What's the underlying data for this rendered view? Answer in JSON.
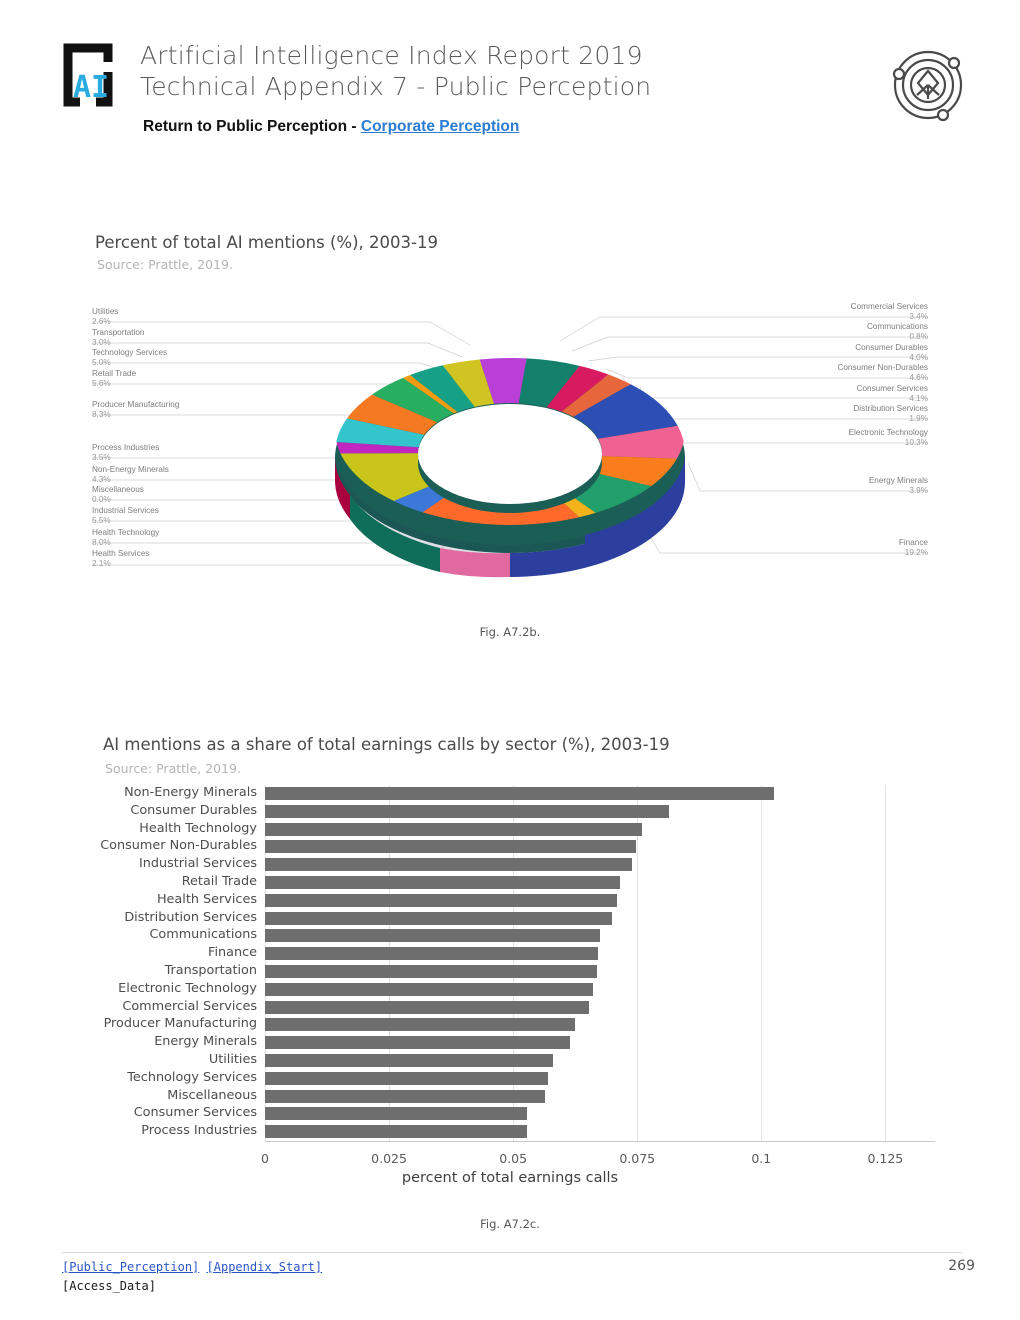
{
  "header": {
    "logo_alt": "AI Index logo",
    "title_line1": "Artificial Intelligence Index Report 2019",
    "title_line2": "Technical Appendix 7 - Public Perception",
    "return_prefix": "Return to Public Perception - ",
    "return_link": "Corporate Perception"
  },
  "figure1": {
    "title": "Percent of total AI mentions (%), 2003-19",
    "source": "Source: Prattle, 2019.",
    "caption": "Fig. A7.2b."
  },
  "figure2": {
    "title": "AI mentions as a share of total earnings calls by sector (%), 2003-19",
    "source": "Source: Prattle, 2019.",
    "caption": "Fig. A7.2c.",
    "xlabel": "percent of total earnings calls"
  },
  "footer": {
    "link1": "[Public_Perception]",
    "link2": "[Appendix_Start]",
    "link3": "[Access_Data]",
    "page": "269"
  },
  "chart_data": [
    {
      "type": "pie",
      "title": "Percent of total AI mentions (%), 2003-19",
      "subtitle": "Source: Prattle, 2019.",
      "unit": "%",
      "donut": true,
      "labels": [
        "Commercial Services",
        "Communications",
        "Consumer Durables",
        "Consumer Non-Durables",
        "Consumer Services",
        "Distribution Services",
        "Electronic Technology",
        "Energy Minerals",
        "Finance",
        "Health Services",
        "Health Technology",
        "Industrial Services",
        "Miscellaneous",
        "Non-Energy Minerals",
        "Process Industries",
        "Producer Manufacturing",
        "Retail Trade",
        "Technology Services",
        "Transportation",
        "Utilities"
      ],
      "values": [
        3.4,
        0.8,
        4.0,
        4.6,
        4.1,
        1.9,
        10.3,
        3.9,
        19.2,
        2.1,
        8.0,
        5.5,
        0.0,
        4.3,
        3.5,
        8.3,
        5.6,
        5.0,
        3.0,
        2.6
      ],
      "value_labels": [
        "3.4%",
        "0.8%",
        "4.0%",
        "4.6%",
        "4.1%",
        "1.9%",
        "10.3%",
        "3.9%",
        "19.2%",
        "2.1%",
        "8.0%",
        "5.5%",
        "0.0%",
        "4.3%",
        "3.5%",
        "8.3%",
        "5.6%",
        "5.0%",
        "3.0%",
        "2.6%"
      ],
      "colors": [
        "#16a085",
        "#f39c12",
        "#27ae60",
        "#f47920",
        "#33c4cc",
        "#c026c0",
        "#c9c51a",
        "#3b78d8",
        "#ff6a2b",
        "#f5b31b",
        "#22a06b",
        "#f97c1d",
        "#6ec9d2",
        "#b93fd6",
        "#cfc422",
        "#2d4fb5",
        "#f06292",
        "#12806a",
        "#d81b60",
        "#e8663c"
      ],
      "legend_position": "both-sides",
      "label_groups": {
        "left": [
          {
            "name": "Utilities",
            "value": "2.6%"
          },
          {
            "name": "Transportation",
            "value": "3.0%"
          },
          {
            "name": "Technology Services",
            "value": "5.0%"
          },
          {
            "name": "Retail Trade",
            "value": "5.6%"
          },
          {
            "name": "Producer Manufacturing",
            "value": "8.3%"
          },
          {
            "name": "Process Industries",
            "value": "3.5%"
          },
          {
            "name": "Non-Energy Minerals",
            "value": "4.3%"
          },
          {
            "name": "Miscellaneous",
            "value": "0.0%"
          },
          {
            "name": "Industrial Services",
            "value": "5.5%"
          },
          {
            "name": "Health Technology",
            "value": "8.0%"
          },
          {
            "name": "Health Services",
            "value": "2.1%"
          }
        ],
        "right": [
          {
            "name": "Commercial Services",
            "value": "3.4%"
          },
          {
            "name": "Communications",
            "value": "0.8%"
          },
          {
            "name": "Consumer Durables",
            "value": "4.0%"
          },
          {
            "name": "Consumer Non-Durables",
            "value": "4.6%"
          },
          {
            "name": "Consumer Services",
            "value": "4.1%"
          },
          {
            "name": "Distribution Services",
            "value": "1.9%"
          },
          {
            "name": "Electronic Technology",
            "value": "10.3%"
          },
          {
            "name": "Energy Minerals",
            "value": "3.9%"
          },
          {
            "name": "Finance",
            "value": "19.2%"
          }
        ]
      }
    },
    {
      "type": "bar",
      "orientation": "horizontal",
      "title": "AI mentions as a share of total earnings calls by sector (%), 2003-19",
      "subtitle": "Source: Prattle, 2019.",
      "xlabel": "percent of total earnings calls",
      "ylabel": "",
      "xlim": [
        0,
        0.135
      ],
      "xticks": [
        0,
        0.025,
        0.05,
        0.075,
        0.1,
        0.125
      ],
      "xtick_labels": [
        "0",
        "0.025",
        "0.05",
        "0.075",
        "0.1",
        "0.125"
      ],
      "grid": true,
      "bar_color": "#6e6e6e",
      "categories": [
        "Non-Energy Minerals",
        "Consumer Durables",
        "Health Technology",
        "Consumer Non-Durables",
        "Industrial Services",
        "Retail Trade",
        "Health Services",
        "Distribution Services",
        "Communications",
        "Finance",
        "Transportation",
        "Electronic Technology",
        "Commercial Services",
        "Producer Manufacturing",
        "Energy Minerals",
        "Utilities",
        "Technology Services",
        "Miscellaneous",
        "Consumer Services",
        "Process Industries"
      ],
      "values": [
        0.1025,
        0.0815,
        0.076,
        0.0748,
        0.074,
        0.0715,
        0.071,
        0.07,
        0.0675,
        0.067,
        0.0668,
        0.066,
        0.0652,
        0.0625,
        0.0615,
        0.058,
        0.057,
        0.0565,
        0.0528,
        0.0528
      ]
    }
  ]
}
